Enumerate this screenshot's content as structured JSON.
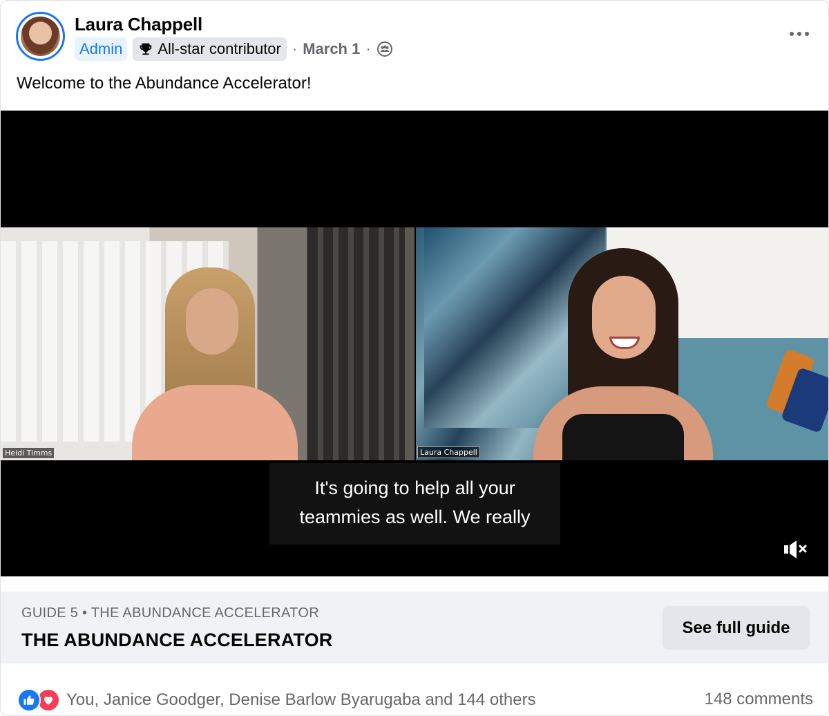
{
  "post": {
    "author": "Laura Chappell",
    "badges": {
      "admin": "Admin",
      "contributor": "All-star contributor"
    },
    "date": "March 1",
    "separator": "·",
    "caption": "Welcome to the Abundance Accelerator!",
    "icons": {
      "more": "more-horizontal-icon",
      "trophy": "trophy-icon",
      "audience": "group-icon"
    }
  },
  "video": {
    "participants": [
      "Heidi Timms",
      "Laura Chappell"
    ],
    "subtitle_line1": "It's going to help all your",
    "subtitle_line2": "teammies as well. We really",
    "mute_icon": "speaker-muted-icon"
  },
  "guide": {
    "subtitle": "GUIDE 5 • THE ABUNDANCE ACCELERATOR",
    "title": "THE ABUNDANCE ACCELERATOR",
    "button": "See full guide"
  },
  "footer": {
    "reactions_text": "You, Janice Goodger, Denise Barlow Byarugaba and 144 others",
    "comments": "148 comments",
    "colors": {
      "like": "#1877f2",
      "love": "#f33e58"
    }
  }
}
